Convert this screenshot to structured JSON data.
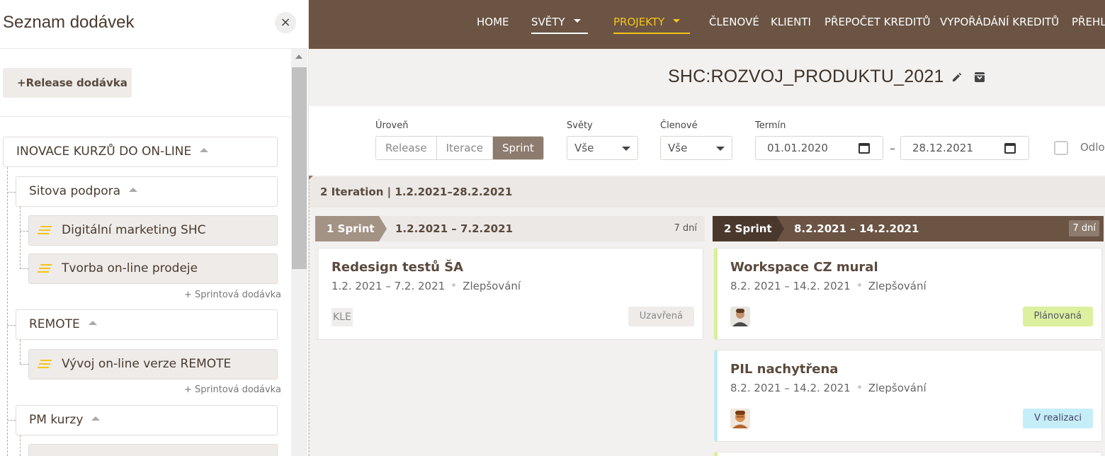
{
  "nav": {
    "items": [
      {
        "label": "HOME"
      },
      {
        "label": "SVĚTY"
      },
      {
        "label": "PROJEKTY"
      },
      {
        "label": "ČLENOVÉ"
      },
      {
        "label": "KLIENTI"
      },
      {
        "label": "PŘEPOČET KREDITŮ"
      },
      {
        "label": "VYPOŘÁDÁNÍ KREDITŮ"
      },
      {
        "label": "PŘEHL"
      }
    ]
  },
  "project": {
    "title": "SHC:ROZVOJ_PRODUKTU_2021"
  },
  "filters": {
    "level_label": "Úroveň",
    "levels": [
      "Release",
      "Iterace",
      "Sprint"
    ],
    "selected_level": "Sprint",
    "worlds_label": "Světy",
    "worlds_value": "Vše",
    "members_label": "Členové",
    "members_value": "Vše",
    "term_label": "Termín",
    "date_from": "01.01.2020",
    "date_to": "28.12.2021",
    "dash": "–",
    "checkbox_label": "Odlo"
  },
  "iteration": {
    "label": "2 Iteration | 1.2.2021–28.2.2021"
  },
  "sprints": [
    {
      "name": "1 Sprint",
      "range": "1.2.2021 – 7.2.2021",
      "days": "7 dní"
    },
    {
      "name": "2 Sprint",
      "range": "8.2.2021 – 14.2.2021",
      "days": "7 dní"
    }
  ],
  "cards": [
    {
      "title": "Redesign testů ŠA",
      "dates": "1.2. 2021 – 7.2. 2021",
      "type": "Zlepšování",
      "assignee": "KLE",
      "status": "Uzavřená"
    },
    {
      "title": "Workspace CZ mural",
      "dates": "8.2. 2021 – 14.2. 2021",
      "type": "Zlepšování",
      "status": "Plánovaná"
    },
    {
      "title": "PIL nachytřena",
      "dates": "8.2. 2021 – 14.2. 2021",
      "type": "Zlepšování",
      "status": "V realizaci"
    }
  ],
  "sidebar": {
    "title": "Seznam dodávek",
    "close": "×",
    "release_button": "+Release dodávka",
    "release": {
      "label": "INOVACE KURZŮ DO ON-LINE"
    },
    "groups": [
      {
        "label": "Sitova podpora",
        "leaves": [
          "Digitální marketing SHC",
          "Tvorba on-line prodeje"
        ],
        "add": "+ Sprintová dodávka"
      },
      {
        "label": "REMOTE",
        "leaves": [
          "Vývoj on-line verze REMOTE"
        ],
        "add": "+ Sprintová dodávka"
      },
      {
        "label": "PM kurzy"
      }
    ]
  }
}
